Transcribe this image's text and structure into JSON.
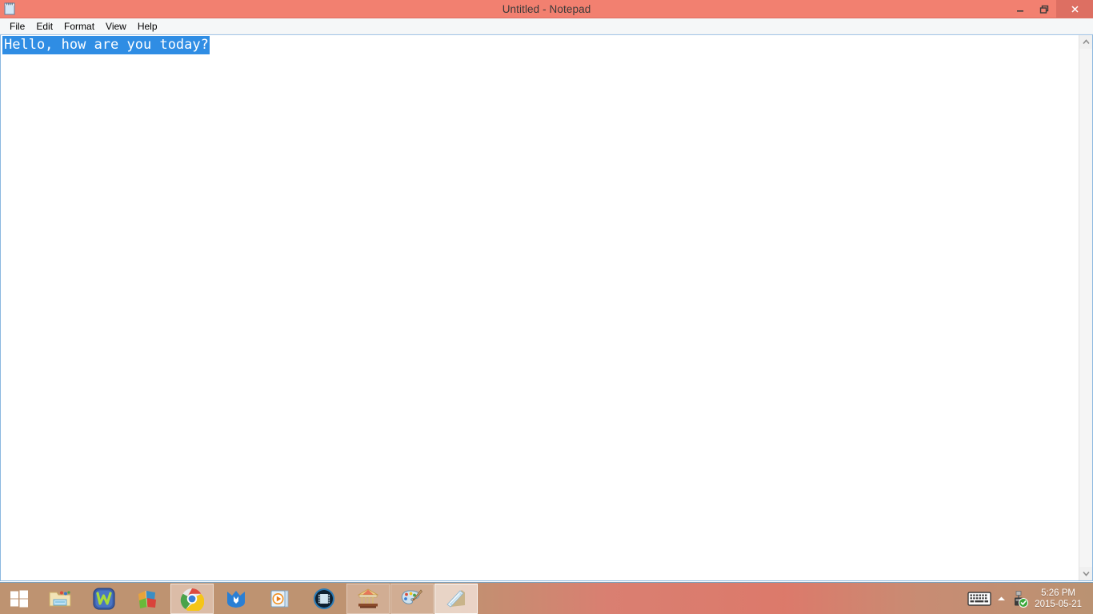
{
  "window": {
    "title": "Untitled - Notepad",
    "icon": "notepad-icon",
    "controls": {
      "minimize": "–",
      "maximize": "❐",
      "close": "✕"
    }
  },
  "menu": {
    "items": [
      {
        "label": "File"
      },
      {
        "label": "Edit"
      },
      {
        "label": "Format"
      },
      {
        "label": "View"
      },
      {
        "label": "Help"
      }
    ]
  },
  "editor": {
    "text": "Hello, how are you today?",
    "placeholder": "",
    "selected": true
  },
  "scrollbar": {
    "up_arrow": "▲",
    "down_arrow": "▼"
  },
  "taskbar": {
    "start_label": "Start",
    "items": [
      {
        "name": "file-explorer",
        "label": "File Explorer",
        "state": "pinned"
      },
      {
        "name": "wps-office",
        "label": "WPS Office",
        "state": "pinned"
      },
      {
        "name": "winrar",
        "label": "WinRAR",
        "state": "pinned"
      },
      {
        "name": "google-chrome",
        "label": "Google Chrome",
        "state": "hovered"
      },
      {
        "name": "malwarebytes",
        "label": "Malwarebytes",
        "state": "pinned"
      },
      {
        "name": "media-player",
        "label": "Media Player",
        "state": "pinned"
      },
      {
        "name": "video-player",
        "label": "Video Player",
        "state": "pinned"
      },
      {
        "name": "carousel-app",
        "label": "Carousel",
        "state": "running"
      },
      {
        "name": "paint",
        "label": "Paint",
        "state": "running"
      },
      {
        "name": "notepad",
        "label": "Untitled - Notepad",
        "state": "active"
      }
    ]
  },
  "tray": {
    "keyboard_icon": "on-screen-keyboard-icon",
    "show_hidden_icon": "chevron-up-icon",
    "usb_icon": "safely-remove-hardware-icon",
    "time": "5:26 PM",
    "date": "2015-05-21"
  },
  "colors": {
    "title_bar": "#f28070",
    "close_button": "#dd6f62",
    "selection": "#2f8de4",
    "taskbar_tan": "#be9371",
    "desktop": "#b99272"
  }
}
